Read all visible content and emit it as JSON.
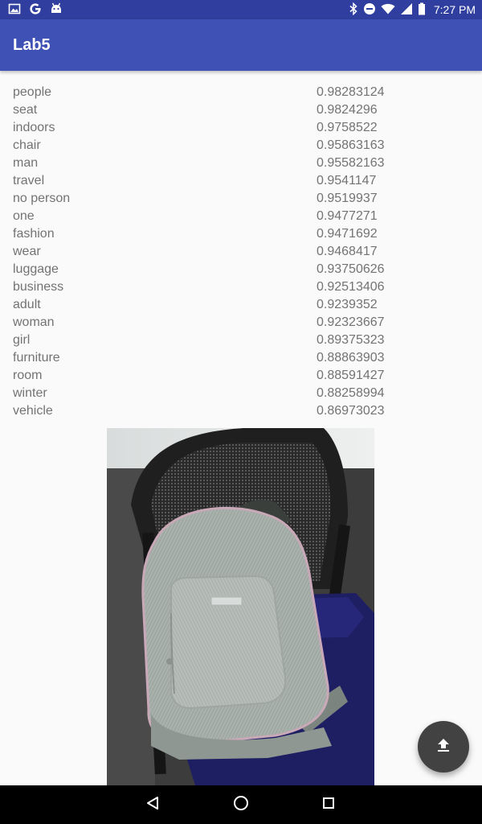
{
  "status_bar": {
    "time": "7:27 PM",
    "left_icons": [
      "image-icon",
      "google-icon",
      "android-icon"
    ],
    "right_icons": [
      "bluetooth-icon",
      "do-not-disturb-icon",
      "wifi-icon",
      "signal-icon",
      "battery-icon"
    ]
  },
  "app_bar": {
    "title": "Lab5"
  },
  "results": [
    {
      "label": "people",
      "score": "0.98283124"
    },
    {
      "label": "seat",
      "score": "0.9824296"
    },
    {
      "label": "indoors",
      "score": "0.9758522"
    },
    {
      "label": "chair",
      "score": "0.95863163"
    },
    {
      "label": "man",
      "score": "0.95582163"
    },
    {
      "label": "travel",
      "score": "0.9541147"
    },
    {
      "label": "no person",
      "score": "0.9519937"
    },
    {
      "label": "one",
      "score": "0.9477271"
    },
    {
      "label": "fashion",
      "score": "0.9471692"
    },
    {
      "label": "wear",
      "score": "0.9468417"
    },
    {
      "label": "luggage",
      "score": "0.93750626"
    },
    {
      "label": "business",
      "score": "0.92513406"
    },
    {
      "label": "adult",
      "score": "0.9239352"
    },
    {
      "label": "woman",
      "score": "0.92323667"
    },
    {
      "label": "girl",
      "score": "0.89375323"
    },
    {
      "label": "furniture",
      "score": "0.88863903"
    },
    {
      "label": "room",
      "score": "0.88591427"
    },
    {
      "label": "winter",
      "score": "0.88258994"
    },
    {
      "label": "vehicle",
      "score": "0.86973023"
    }
  ],
  "photo": {
    "subject": "backpack-on-chair-photo"
  },
  "fab": {
    "icon": "upload-icon"
  },
  "nav_bar": {
    "buttons": [
      "back-icon",
      "home-icon",
      "recents-icon"
    ]
  },
  "colors": {
    "status_bar": "#303f9f",
    "app_bar": "#3f51b5",
    "fab": "#424242",
    "text": "#737373"
  }
}
